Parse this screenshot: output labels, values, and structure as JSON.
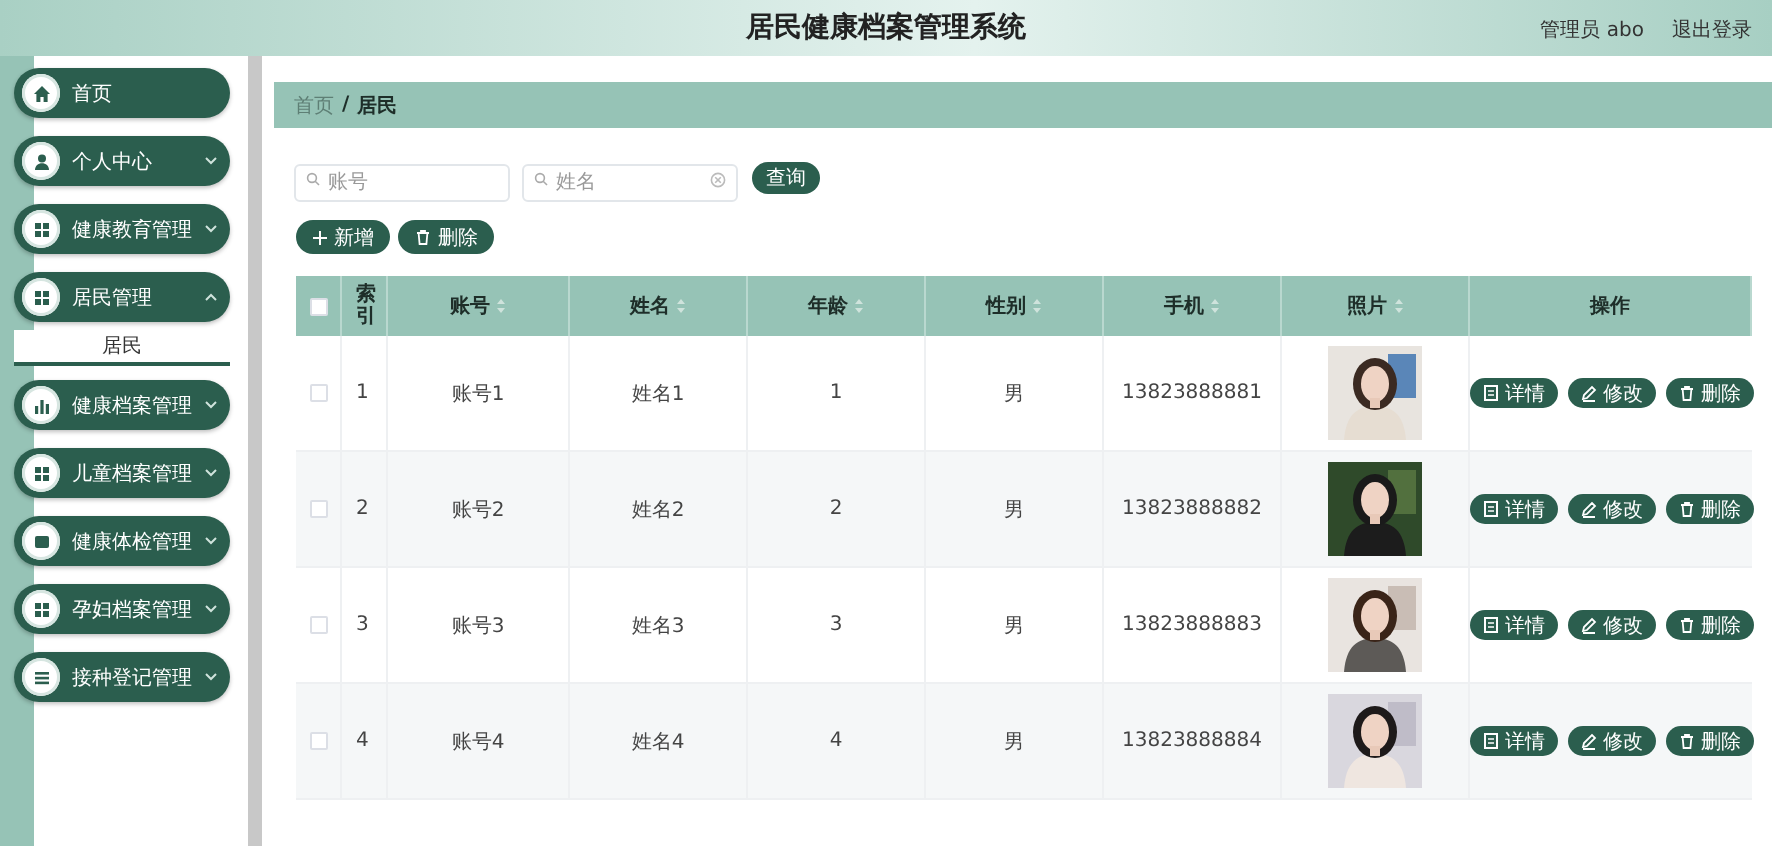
{
  "header": {
    "title": "居民健康档案管理系统",
    "user": "管理员 abo",
    "logout": "退出登录"
  },
  "sidebar": {
    "items": [
      {
        "label": "首页",
        "expandable": false
      },
      {
        "label": "个人中心",
        "expandable": true,
        "expanded": false
      },
      {
        "label": "健康教育管理",
        "expandable": true,
        "expanded": false
      },
      {
        "label": "居民管理",
        "expandable": true,
        "expanded": true,
        "children": [
          {
            "label": "居民",
            "selected": true
          }
        ]
      },
      {
        "label": "健康档案管理",
        "expandable": true,
        "expanded": false
      },
      {
        "label": "儿童档案管理",
        "expandable": true,
        "expanded": false
      },
      {
        "label": "健康体检管理",
        "expandable": true,
        "expanded": false
      },
      {
        "label": "孕妇档案管理",
        "expandable": true,
        "expanded": false
      },
      {
        "label": "接种登记管理",
        "expandable": true,
        "expanded": false
      }
    ]
  },
  "breadcrumb": [
    "首页",
    "/",
    "居民"
  ],
  "search": {
    "fields": [
      {
        "placeholder": "账号",
        "clearable": false
      },
      {
        "placeholder": "姓名",
        "clearable": true
      }
    ],
    "button": "查询"
  },
  "toolbar": {
    "add": "新增",
    "delete": "删除"
  },
  "table": {
    "header_checkbox": {
      "checked": false
    },
    "columns": [
      {
        "label": "索引",
        "sortable": false
      },
      {
        "label": "账号",
        "sortable": true
      },
      {
        "label": "姓名",
        "sortable": true
      },
      {
        "label": "年龄",
        "sortable": true
      },
      {
        "label": "性别",
        "sortable": true
      },
      {
        "label": "手机",
        "sortable": true
      },
      {
        "label": "照片",
        "sortable": true
      },
      {
        "label": "操作",
        "sortable": false
      }
    ],
    "rows": [
      {
        "checked": false,
        "cells": [
          "1",
          "账号1",
          "姓名1",
          "1",
          "男",
          "13823888881"
        ],
        "actions": [
          "详情",
          "修改",
          "删除"
        ]
      },
      {
        "checked": false,
        "cells": [
          "2",
          "账号2",
          "姓名2",
          "2",
          "男",
          "13823888882"
        ],
        "actions": [
          "详情",
          "修改",
          "删除"
        ]
      },
      {
        "checked": false,
        "cells": [
          "3",
          "账号3",
          "姓名3",
          "3",
          "男",
          "13823888883"
        ],
        "actions": [
          "详情",
          "修改",
          "删除"
        ]
      },
      {
        "checked": false,
        "cells": [
          "4",
          "账号4",
          "姓名4",
          "4",
          "男",
          "13823888884"
        ],
        "actions": [
          "详情",
          "修改",
          "删除"
        ]
      }
    ]
  }
}
